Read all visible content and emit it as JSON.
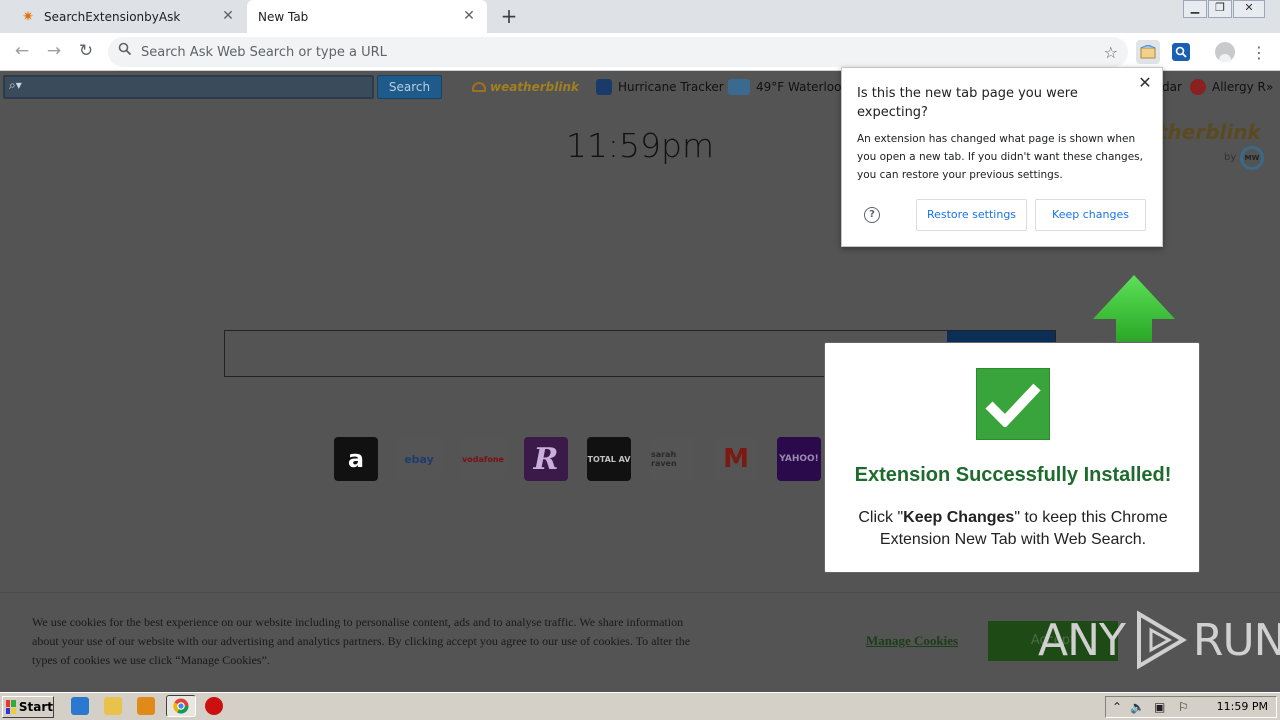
{
  "tabs": [
    {
      "title": "SearchExtensionbyAsk",
      "active": false
    },
    {
      "title": "New Tab",
      "active": true
    }
  ],
  "omnibox": {
    "placeholder": "Search Ask Web Search or type a URL"
  },
  "asktoolbar": {
    "search_label": "Search",
    "bookmarks": [
      {
        "label": "weatherblink"
      },
      {
        "label": "Hurricane Tracker"
      },
      {
        "label": "49°F Waterloo,"
      },
      {
        "label": "dar"
      },
      {
        "label": "Allergy R"
      }
    ],
    "overflow": "»"
  },
  "page": {
    "clock": "11:59pm",
    "weatherblink_logo": "therblink",
    "weatherblink_by": "by",
    "mw_badge": "MW",
    "tiles": [
      {
        "name": "amazon",
        "text": "a",
        "bg": "#111111",
        "fg": "#ffffff"
      },
      {
        "name": "ebay",
        "text": "ebay",
        "bg": "#555555",
        "fg": "#1f3b6e"
      },
      {
        "name": "vodafone",
        "text": "vodafone",
        "bg": "#555555",
        "fg": "#7a1010"
      },
      {
        "name": "r-logo",
        "text": "R",
        "bg": "#3b1a4a",
        "fg": "#c9b0d8"
      },
      {
        "name": "total-av",
        "text": "TOTAL AV",
        "bg": "#111111",
        "fg": "#c0c0c0"
      },
      {
        "name": "sarah-raven",
        "text": "sarah raven",
        "bg": "#555555",
        "fg": "#2a2a2a"
      },
      {
        "name": "gmail",
        "text": "M",
        "bg": "#555555",
        "fg": "#7a1a12"
      },
      {
        "name": "yahoo",
        "text": "YAHOO!",
        "bg": "#2a0a4a",
        "fg": "#9a8ab0"
      }
    ]
  },
  "cookie": {
    "text": "We use cookies for the best experience on our website including to personalise content, ads and to analyse traffic. We share information about your use of our website with our advertising and analytics partners. By clicking accept you agree to our use of cookies. To alter the types of cookies we use click “Manage Cookies”.",
    "manage_label": "Manage Cookies",
    "accept_label": "Accept"
  },
  "watermark": {
    "left": "ANY",
    "right": "RUN"
  },
  "popup": {
    "title": "Is this the new tab page you were expecting?",
    "body": "An extension has changed what page is shown when you open a new tab. If you didn't want these changes, you can restore your previous settings.",
    "restore_label": "Restore settings",
    "keep_label": "Keep changes",
    "help": "?"
  },
  "success": {
    "title": "Extension Successfully Installed!",
    "body_prefix": "Click \"",
    "body_bold": "Keep Changes",
    "body_suffix": "\" to keep this Chrome Extension New Tab with Web Search."
  },
  "taskbar": {
    "start_label": "Start",
    "clock": "11:59 PM"
  },
  "colors": {
    "success_green": "#3aa43c",
    "chrome_blue": "#1a73e8",
    "arrow_green": "#3ec23a"
  }
}
